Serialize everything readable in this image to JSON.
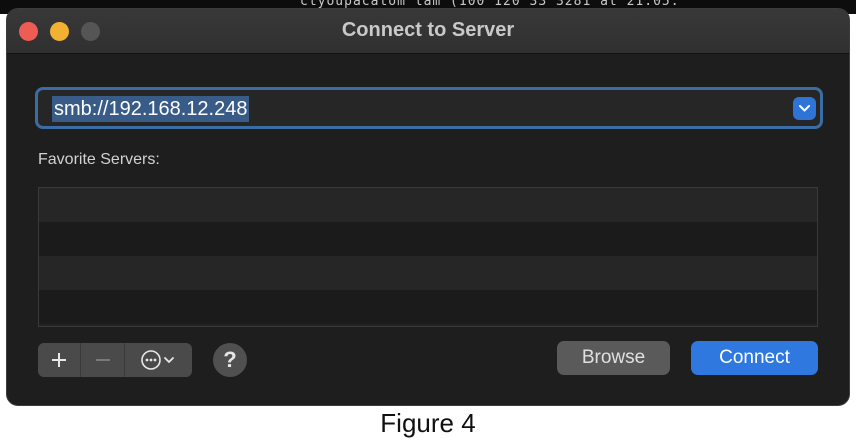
{
  "background_text": "ctyoupacatom lam (100 120 33 3281 at 21:05:",
  "window": {
    "title": "Connect to Server"
  },
  "address": {
    "value": "smb://192.168.12.248"
  },
  "favorites": {
    "label": "Favorite Servers:",
    "rows": [
      "",
      "",
      "",
      ""
    ]
  },
  "toolbar": {
    "add_icon": "plus-icon",
    "remove_icon": "minus-icon",
    "more_icon": "ellipsis-circle-icon",
    "help_label": "?"
  },
  "buttons": {
    "browse": "Browse",
    "connect": "Connect"
  },
  "caption": "Figure 4",
  "colors": {
    "accent": "#2f78df",
    "close": "#ee5c54",
    "minimize": "#f2b131",
    "zoom": "#555555"
  }
}
